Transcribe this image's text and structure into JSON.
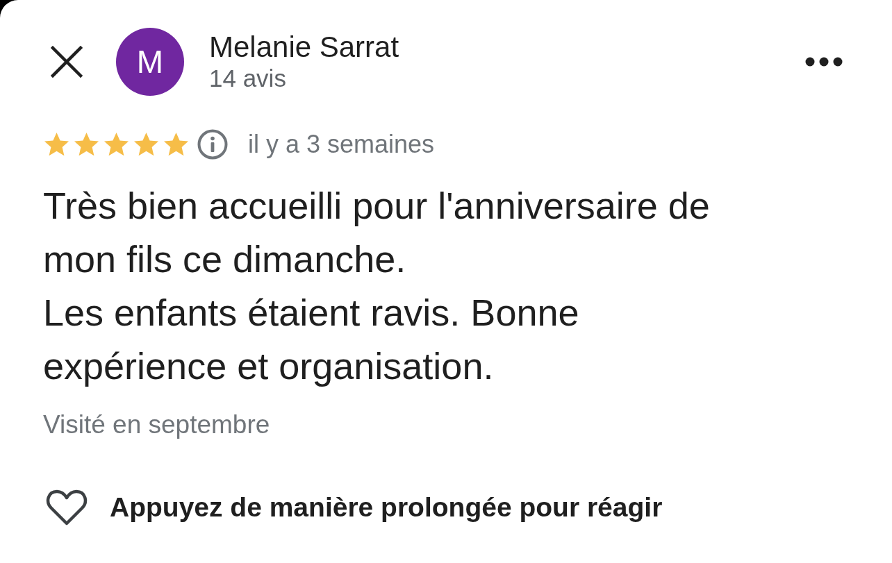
{
  "header": {
    "avatar_letter": "M",
    "name": "Melanie Sarrat",
    "review_count": "14 avis"
  },
  "review": {
    "stars": 5,
    "time": "il y a 3 semaines",
    "text": "Très bien accueilli pour l'anniversaire de mon fils ce dimanche.\nLes enfants étaient ravis. Bonne expérience et organisation.",
    "visited": "Visité en septembre"
  },
  "reaction": {
    "label": "Appuyez de manière prolongée pour réagir"
  }
}
